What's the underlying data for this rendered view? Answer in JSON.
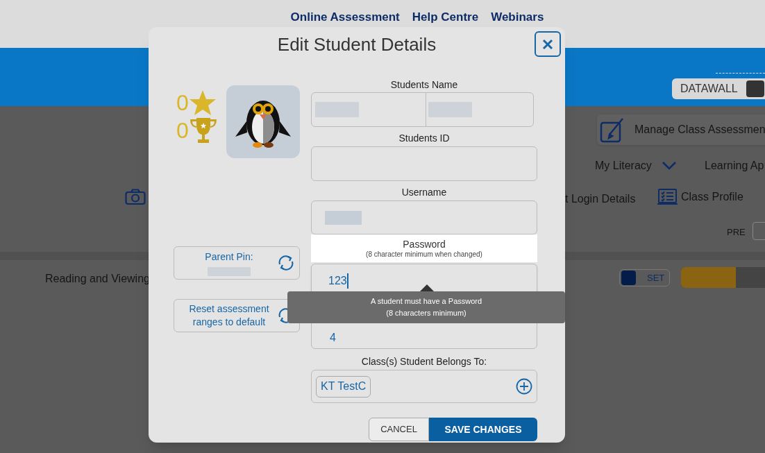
{
  "top_nav": {
    "links": [
      "Online Assessment",
      "Help Centre",
      "Webinars"
    ]
  },
  "background": {
    "datawall_label": "DATAWALL",
    "manage_button": "Manage Class Assessmen",
    "nav_items": [
      "My Literacy",
      "Learning Ap"
    ],
    "toolbar_items": [
      "t Login Details",
      "Class Profile"
    ],
    "pre_label": "PRE",
    "row_label": "Reading and Viewing",
    "toggle_label": "SET",
    "progress": {
      "level": 0.61
    }
  },
  "modal": {
    "title": "Edit Student Details",
    "stars": "0",
    "trophies": "0",
    "parent_pin": {
      "label": "Parent Pin:"
    },
    "reset_button": {
      "label": "Reset assessment ranges to default"
    },
    "fields": [
      {
        "label": "Students Name",
        "kind": "split"
      },
      {
        "label": "Students ID",
        "kind": "empty"
      },
      {
        "label": "Username",
        "kind": "single"
      }
    ],
    "password": {
      "label": "Password",
      "hint": "(8 character minimum when changed)",
      "value": "123"
    },
    "tooltip": [
      "A student must have a Password",
      "(8 characters minimum)"
    ],
    "year_level": {
      "value": "4"
    },
    "classes": {
      "label": "Class(s) Student Belongs To:",
      "chips": [
        "KT TestC"
      ]
    },
    "buttons": {
      "cancel": "CANCEL",
      "save": "SAVE CHANGES"
    }
  }
}
